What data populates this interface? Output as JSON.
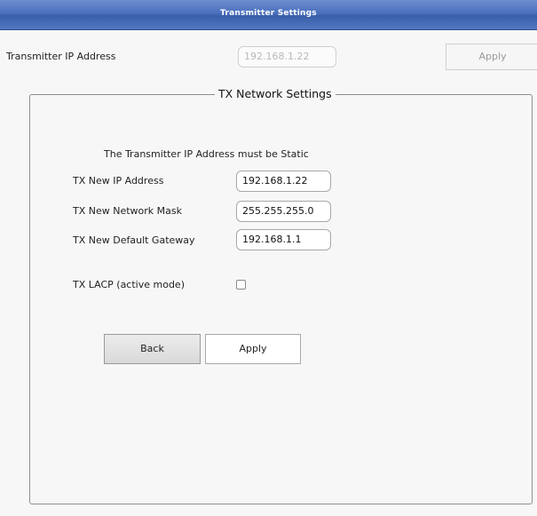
{
  "window": {
    "title": "Transmitter Settings"
  },
  "top": {
    "ip_label": "Transmitter IP Address",
    "ip_value": "192.168.1.22",
    "apply_label": "Apply"
  },
  "group": {
    "legend": "TX Network Settings",
    "note": "The Transmitter IP Address must be Static",
    "new_ip_label": "TX New IP Address",
    "new_ip_value": "192.168.1.22",
    "mask_label": "TX New Network Mask",
    "mask_value": "255.255.255.0",
    "gateway_label": "TX New Default Gateway",
    "gateway_value": "192.168.1.1",
    "lacp_label": "TX LACP (active mode)",
    "lacp_checked": false,
    "back_label": "Back",
    "apply_label": "Apply"
  }
}
